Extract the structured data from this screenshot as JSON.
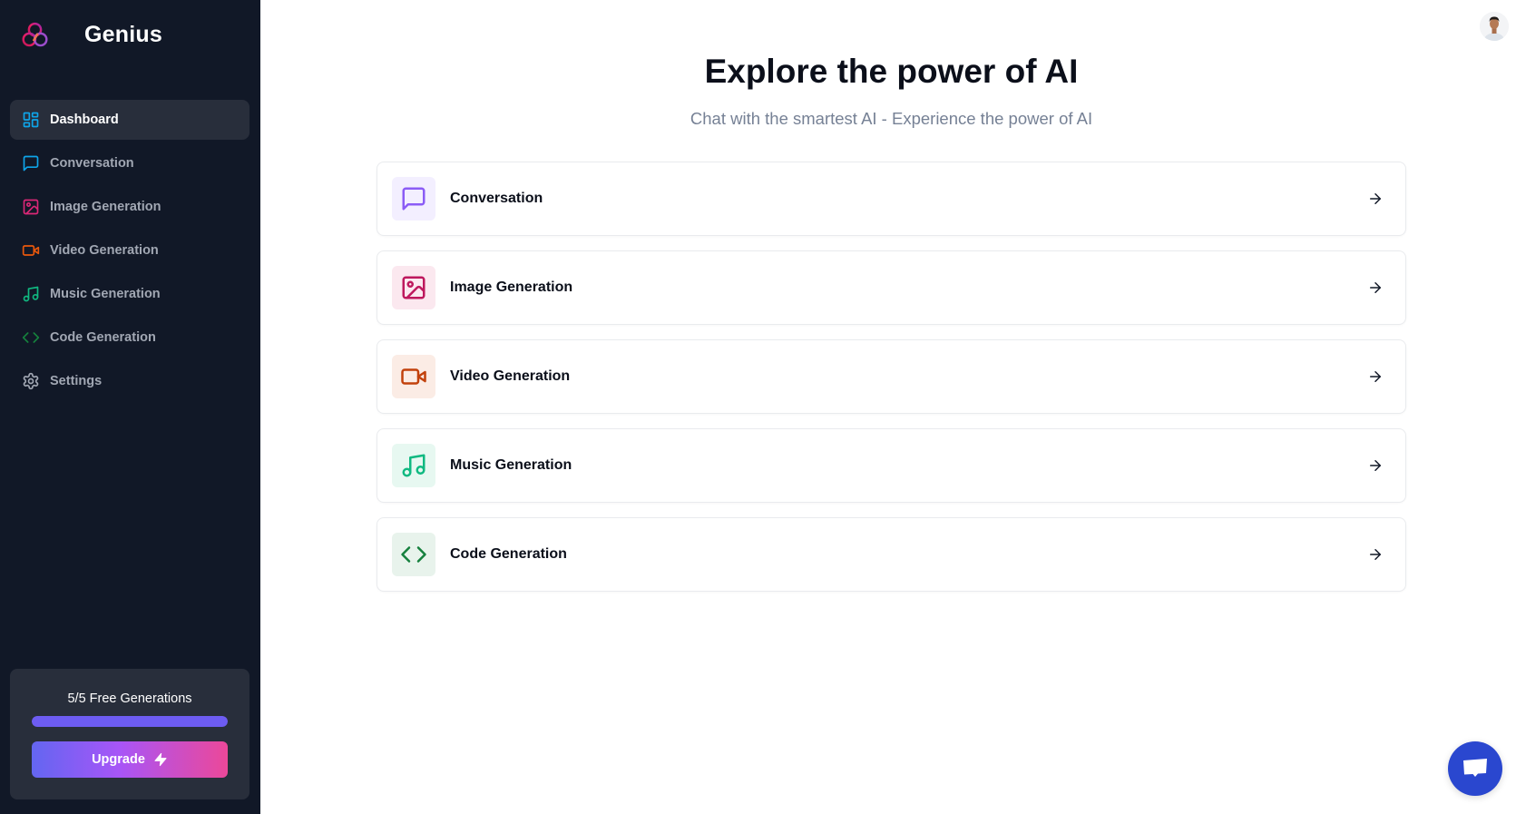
{
  "brand": {
    "name": "Genius",
    "logo_icon": "trefoil-logo"
  },
  "sidebar": {
    "items": [
      {
        "label": "Dashboard",
        "icon": "layout-dashboard-icon",
        "color": "#0ea5e9",
        "active": true
      },
      {
        "label": "Conversation",
        "icon": "message-square-icon",
        "color": "#0ea5e9",
        "active": false
      },
      {
        "label": "Image Generation",
        "icon": "image-icon",
        "color": "#db2777",
        "active": false
      },
      {
        "label": "Video Generation",
        "icon": "video-icon",
        "color": "#ea580c",
        "active": false
      },
      {
        "label": "Music Generation",
        "icon": "music-icon",
        "color": "#10b981",
        "active": false
      },
      {
        "label": "Code Generation",
        "icon": "code-icon",
        "color": "#15803d",
        "active": false
      },
      {
        "label": "Settings",
        "icon": "settings-icon",
        "color": "#a1a7b3",
        "active": false
      }
    ],
    "free_generations": {
      "label": "5/5 Free Generations",
      "used": 5,
      "limit": 5,
      "progress_percent": 100
    },
    "upgrade_label": "Upgrade",
    "upgrade_icon": "zap-icon"
  },
  "main": {
    "title": "Explore the power of AI",
    "subtitle": "Chat with the smartest AI - Experience the power of AI",
    "tools": [
      {
        "label": "Conversation",
        "icon": "message-square-icon",
        "color": "#8b5cf6",
        "bg": "#f3efff"
      },
      {
        "label": "Image Generation",
        "icon": "image-icon",
        "color": "#be185d",
        "bg": "#fbe8ef"
      },
      {
        "label": "Video Generation",
        "icon": "video-icon",
        "color": "#c2410c",
        "bg": "#fbece5"
      },
      {
        "label": "Music Generation",
        "icon": "music-icon",
        "color": "#10b981",
        "bg": "#e7f8f1"
      },
      {
        "label": "Code Generation",
        "icon": "code-icon",
        "color": "#15803d",
        "bg": "#e8f3ec"
      }
    ],
    "arrow_icon": "arrow-right-icon"
  },
  "user": {
    "avatar": "user-avatar"
  },
  "chat_widget": {
    "icon": "chat-bubble-icon",
    "color": "#2a47cf"
  }
}
